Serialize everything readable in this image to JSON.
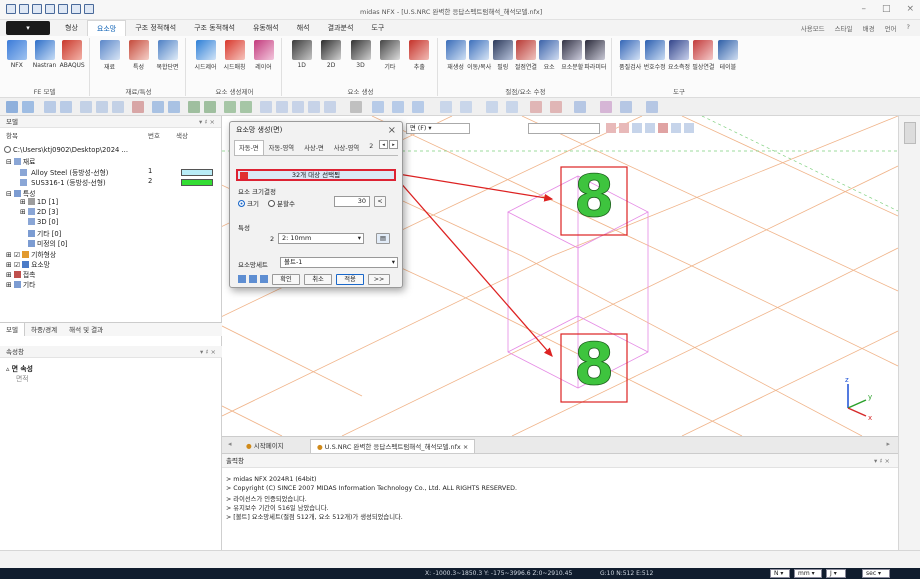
{
  "window": {
    "title": "midas NFX - [U.S.NRC 완벽한 응답스펙트럼해석_해석모델.nfx]",
    "controls": [
      "–",
      "□",
      "×"
    ]
  },
  "menu": {
    "app_button": "",
    "tabs": [
      "형상",
      "요소망",
      "구조 정적해석",
      "구조 동적해석",
      "유동해석",
      "해석",
      "결과분석",
      "도구"
    ],
    "active_tab": 1,
    "right_items": [
      "사용모드",
      "스타일",
      "배경",
      "언어",
      "?"
    ]
  },
  "ribbon": {
    "groups": [
      {
        "label": "FE 모델",
        "buttons": [
          "NFX",
          "Nastran",
          "ABAQUS"
        ]
      },
      {
        "label": "재료/특성",
        "buttons": [
          "재료",
          "특성",
          "복합단면"
        ]
      },
      {
        "label": "요소 생성제어",
        "buttons": [
          "시드제어",
          "시드매칭",
          "레이어"
        ]
      },
      {
        "label": "요소 생성",
        "buttons": [
          "1D",
          "2D",
          "3D",
          "기타",
          "추출"
        ]
      },
      {
        "label": "절점/요소 수정",
        "buttons": [
          "재생성",
          "이동/복사",
          "필링",
          "절점연결",
          "요소",
          "요소분할",
          "파라미터"
        ]
      },
      {
        "label": "도구",
        "buttons": [
          "품질검사",
          "번호수정",
          "요소측정",
          "필상연결",
          "테이블"
        ]
      }
    ]
  },
  "left_panel": {
    "header": "모델",
    "columns": {
      "name": "항목",
      "number": "번호",
      "color": "색상"
    },
    "path": "C:\\Users\\ktj0902\\Desktop\\2024 ...",
    "tree": {
      "materials_label": "재료",
      "materials": [
        {
          "name": "Alloy Steel (등방성-선형)",
          "number": "1",
          "color": "#b8ecf6"
        },
        {
          "name": "SUS316-1 (등방성-선형)",
          "number": "2",
          "color": "#33dd33"
        }
      ],
      "properties_label": "특성",
      "properties": [
        "1D [1]",
        "2D [3]",
        "3D [0]",
        "기타 [0]",
        "미정의 [0]"
      ],
      "geometry": "기하형상",
      "mesh": "요소망",
      "contact": "접촉",
      "other": "기타"
    },
    "tabs": [
      "모델",
      "하중/경계",
      "해석 및 결과"
    ],
    "active_tab": 0,
    "props_header": "속성창",
    "props_section": "면 속성",
    "props_field": "면적"
  },
  "dialog": {
    "title": "요소망 생성(면)",
    "tabs": [
      "자동-면",
      "자동-영역",
      "사상-면",
      "사상-영역",
      "2"
    ],
    "selection_text": "32개 대상 선택됨",
    "size_group": "요소 크기결정",
    "size_option": "크기",
    "div_option": "분할수",
    "size_value": "30",
    "property_label": "특성",
    "property_id": "2",
    "property_value": "2: 10mm",
    "meshset_label": "요소망세트",
    "meshset_value": "볼트-1",
    "buttons": {
      "ok": "확인",
      "cancel": "취소",
      "apply": "적용",
      "more": ">>"
    }
  },
  "viewport": {
    "filter_value": "면 (F)",
    "bolt_glyph": "8",
    "axes": {
      "x": "x",
      "y": "y",
      "z": "z"
    }
  },
  "doc_tabs": [
    "시작페이지",
    "U.S.NRC 완벽한 응답스펙트럼해석_해석모델.nfx"
  ],
  "output": {
    "header": "출력창",
    "lines": [
      "> midas NFX 2024R1 (64bit)",
      "> Copyright (C) SINCE 2007 MIDAS Information Technology Co., Ltd. ALL RIGHTS RESERVED.",
      "> 라이선스가 인증되었습니다.",
      "> 유지보수 기간이 516일 남았습니다.",
      "> [볼트] 요소망세트(절점 512개, 요소 512개)가 생성되었습니다."
    ]
  },
  "status": {
    "coords": "X: -1000.3~1850.3 Y: -175~3996.6 Z:0~2910.45",
    "counts": "G:10 N:512 E:512",
    "unit_force": "N",
    "unit_length": "mm",
    "unit_energy": "J",
    "unit_time": "sec"
  },
  "colors": {
    "accent": "#0a5fb4",
    "highlight_red": "#dd2222",
    "bolt_green": "#3ec43e",
    "grid_orange": "#f0b48a",
    "wire_magenta": "#e58be5"
  }
}
